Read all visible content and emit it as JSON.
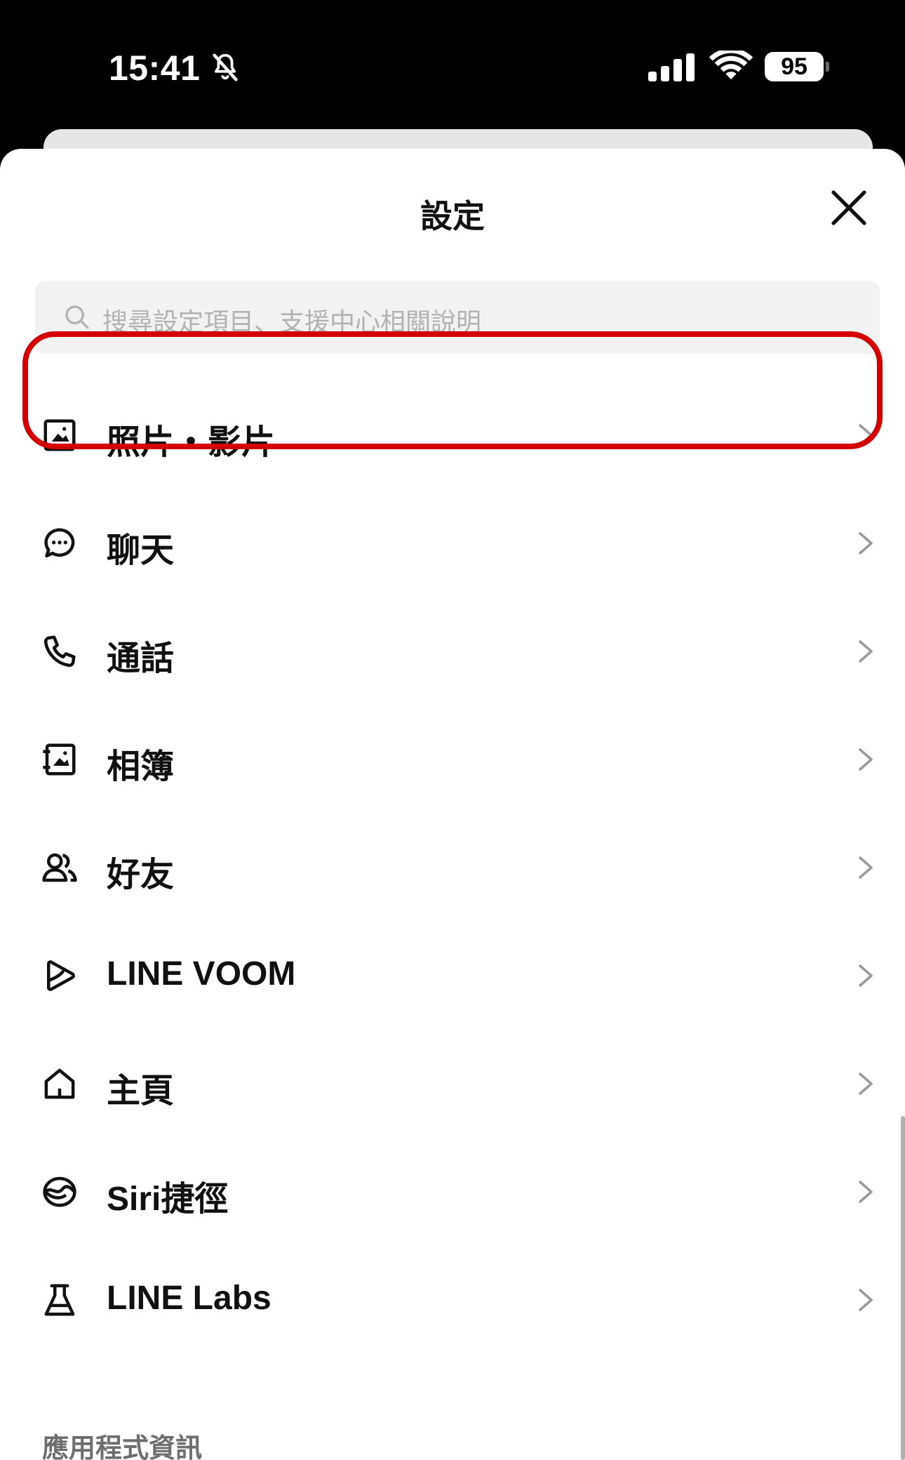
{
  "status_bar": {
    "time": "15:41",
    "battery": "95"
  },
  "header": {
    "title": "設定"
  },
  "search": {
    "placeholder": "搜尋設定項目、支援中心相關說明"
  },
  "menu": [
    {
      "label": "照片・影片",
      "icon": "photo-icon"
    },
    {
      "label": "聊天",
      "icon": "chat-bubble-icon"
    },
    {
      "label": "通話",
      "icon": "phone-icon"
    },
    {
      "label": "相簿",
      "icon": "album-icon"
    },
    {
      "label": "好友",
      "icon": "friends-icon"
    },
    {
      "label": "LINE VOOM",
      "icon": "voom-play-icon"
    },
    {
      "label": "主頁",
      "icon": "home-icon"
    },
    {
      "label": "Siri捷徑",
      "icon": "siri-shortcut-icon"
    },
    {
      "label": "LINE Labs",
      "icon": "flask-icon"
    }
  ],
  "section": {
    "app_info": "應用程式資訊"
  },
  "colors": {
    "highlight": "#d40000",
    "background": "#000000",
    "sheet": "#ffffff",
    "search_bg": "#f2f2f2"
  }
}
